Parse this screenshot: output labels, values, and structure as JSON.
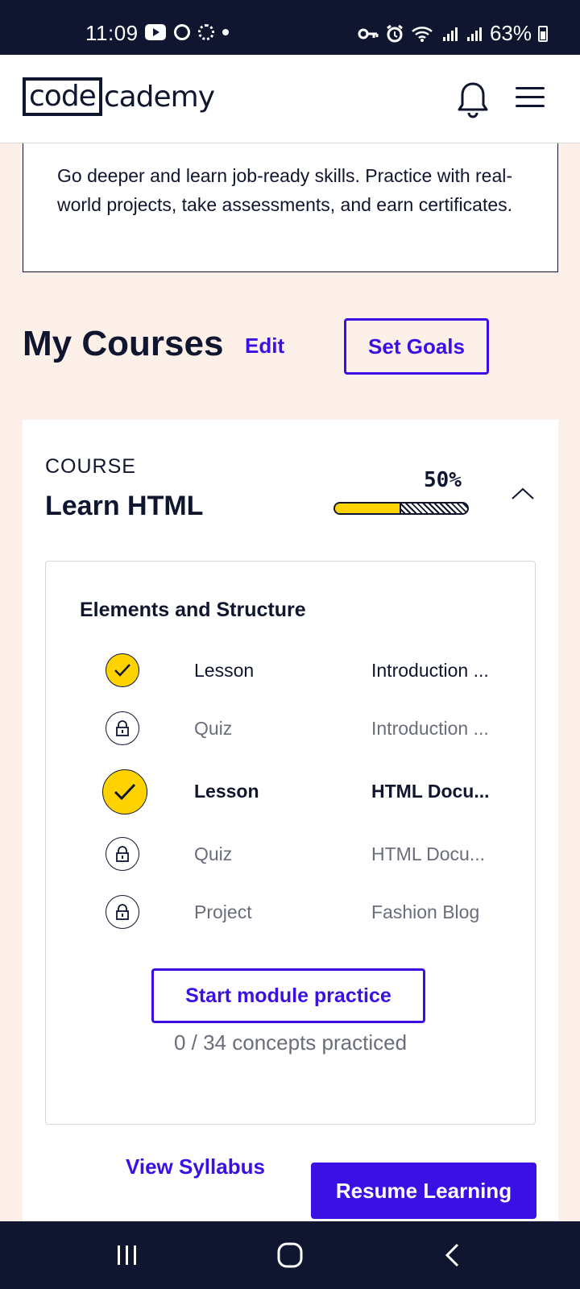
{
  "status_bar": {
    "time": "11:09",
    "battery": "63%"
  },
  "header": {
    "logo_boxed": "code",
    "logo_rest": "cademy",
    "icons": [
      "bell-icon",
      "menu-icon"
    ]
  },
  "upgrade_card": {
    "text": "Go deeper and learn job-ready skills. Practice with real-world projects, take assessments, and earn certificates."
  },
  "my_courses": {
    "title": "My Courses",
    "edit_label": "Edit",
    "set_goals_label": "Set Goals"
  },
  "course": {
    "kicker": "COURSE",
    "title": "Learn HTML",
    "progress_label": "50%",
    "progress_value": 0.5,
    "module": {
      "title": "Elements and Structure",
      "items": [
        {
          "type": "Lesson",
          "name": "Introduction ...",
          "state": "done"
        },
        {
          "type": "Quiz",
          "name": "Introduction ...",
          "state": "locked"
        },
        {
          "type": "Lesson",
          "name": "HTML Docu...",
          "state": "current"
        },
        {
          "type": "Quiz",
          "name": "HTML Docu...",
          "state": "locked"
        },
        {
          "type": "Project",
          "name": "Fashion Blog",
          "state": "locked"
        }
      ],
      "practice_label": "Start module practice",
      "practice_sub": "0 / 34 concepts practiced"
    },
    "view_syllabus_label": "View Syllabus",
    "resume_label": "Resume Learning"
  },
  "colors": {
    "brand_primary": "#3a10e5",
    "navy": "#10162f",
    "yellow": "#ffd300",
    "page_bg": "#fdf0e8"
  }
}
